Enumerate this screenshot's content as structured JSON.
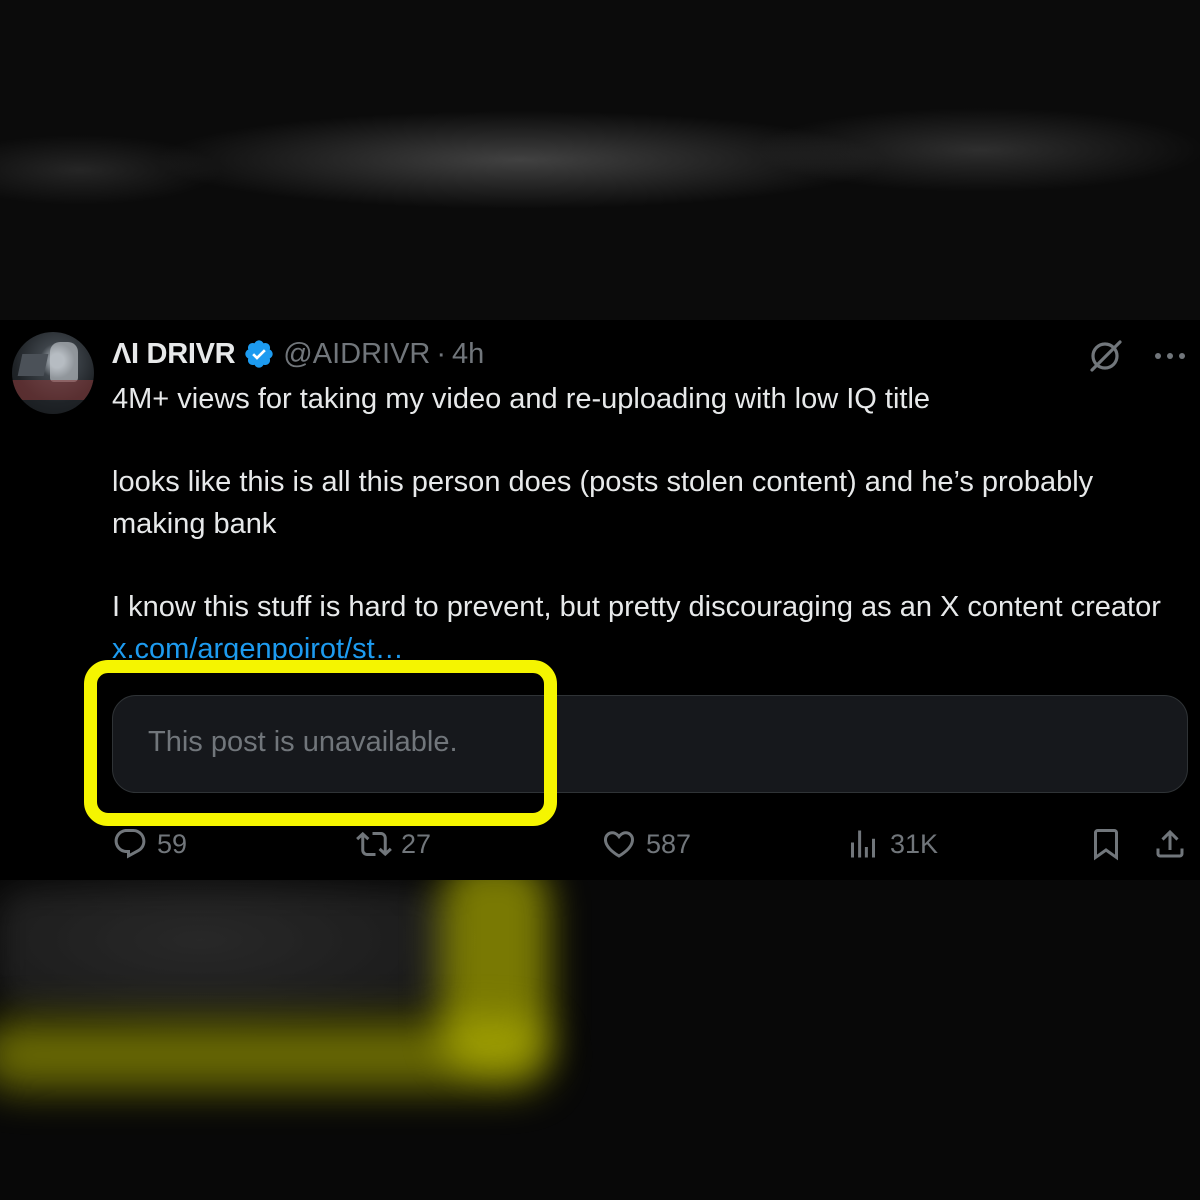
{
  "tweet": {
    "display_name": "ΛI DRIVR",
    "handle": "@AIDRIVR",
    "separator": "·",
    "time": "4h",
    "body": {
      "line1": "4M+ views for taking my video and re-uploading with low IQ title",
      "line2": "looks like this is all this person does (posts stolen content) and he’s probably making bank",
      "line3": "I know this stuff is hard to prevent, but pretty discouraging as an X content creator ",
      "link": "x.com/argenpoirot/st…"
    },
    "quote": {
      "text": "This post is unavailable."
    },
    "actions": {
      "replies": "59",
      "reposts": "27",
      "likes": "587",
      "views": "31K"
    }
  },
  "colors": {
    "background": "#000000",
    "text": "#e7e9ea",
    "muted": "#71767b",
    "link": "#1d9bf0",
    "verified": "#1d9bf0",
    "highlight": "#f5f500"
  },
  "icons": {
    "verified": "verified-badge-icon",
    "grok": "grok-icon",
    "more": "more-options-icon",
    "reply": "reply-icon",
    "repost": "repost-icon",
    "like": "like-icon",
    "views": "views-icon",
    "bookmark": "bookmark-icon",
    "share": "share-icon"
  }
}
